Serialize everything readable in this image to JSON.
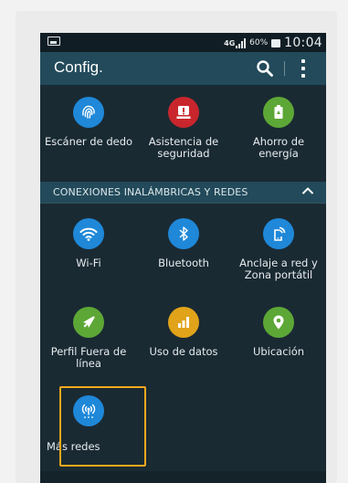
{
  "status_bar": {
    "battery_text": "60%",
    "clock": "10:04",
    "net_label": "4G"
  },
  "app_bar": {
    "title": "Config."
  },
  "top_row": [
    {
      "label": "Escáner de dedo",
      "icon": "fingerprint-icon",
      "color": "#1f88d8"
    },
    {
      "label": "Asistencia de seguridad",
      "icon": "emergency-alert-icon",
      "color": "#c8262c"
    },
    {
      "label": "Ahorro de energía",
      "icon": "battery-saver-icon",
      "color": "#5da736"
    }
  ],
  "section": {
    "title": "CONEXIONES INALÁMBRICAS Y REDES"
  },
  "connections": [
    {
      "label": "Wi-Fi",
      "icon": "wifi-icon",
      "color": "#1f88d8"
    },
    {
      "label": "Bluetooth",
      "icon": "bluetooth-icon",
      "color": "#1f88d8"
    },
    {
      "label": "Anclaje a red y Zona portátil",
      "icon": "tethering-icon",
      "color": "#1f88d8"
    },
    {
      "label": "Perfil Fuera de línea",
      "icon": "airplane-icon",
      "color": "#5da736"
    },
    {
      "label": "Uso de datos",
      "icon": "data-usage-icon",
      "color": "#e0a31a"
    },
    {
      "label": "Ubicación",
      "icon": "location-icon",
      "color": "#5da736"
    },
    {
      "label": "Más redes",
      "icon": "more-networks-icon",
      "color": "#1f88d8"
    }
  ],
  "colors": {
    "background": "#1a2a33",
    "app_bar": "#224a5a",
    "highlight": "#f2a91b"
  }
}
